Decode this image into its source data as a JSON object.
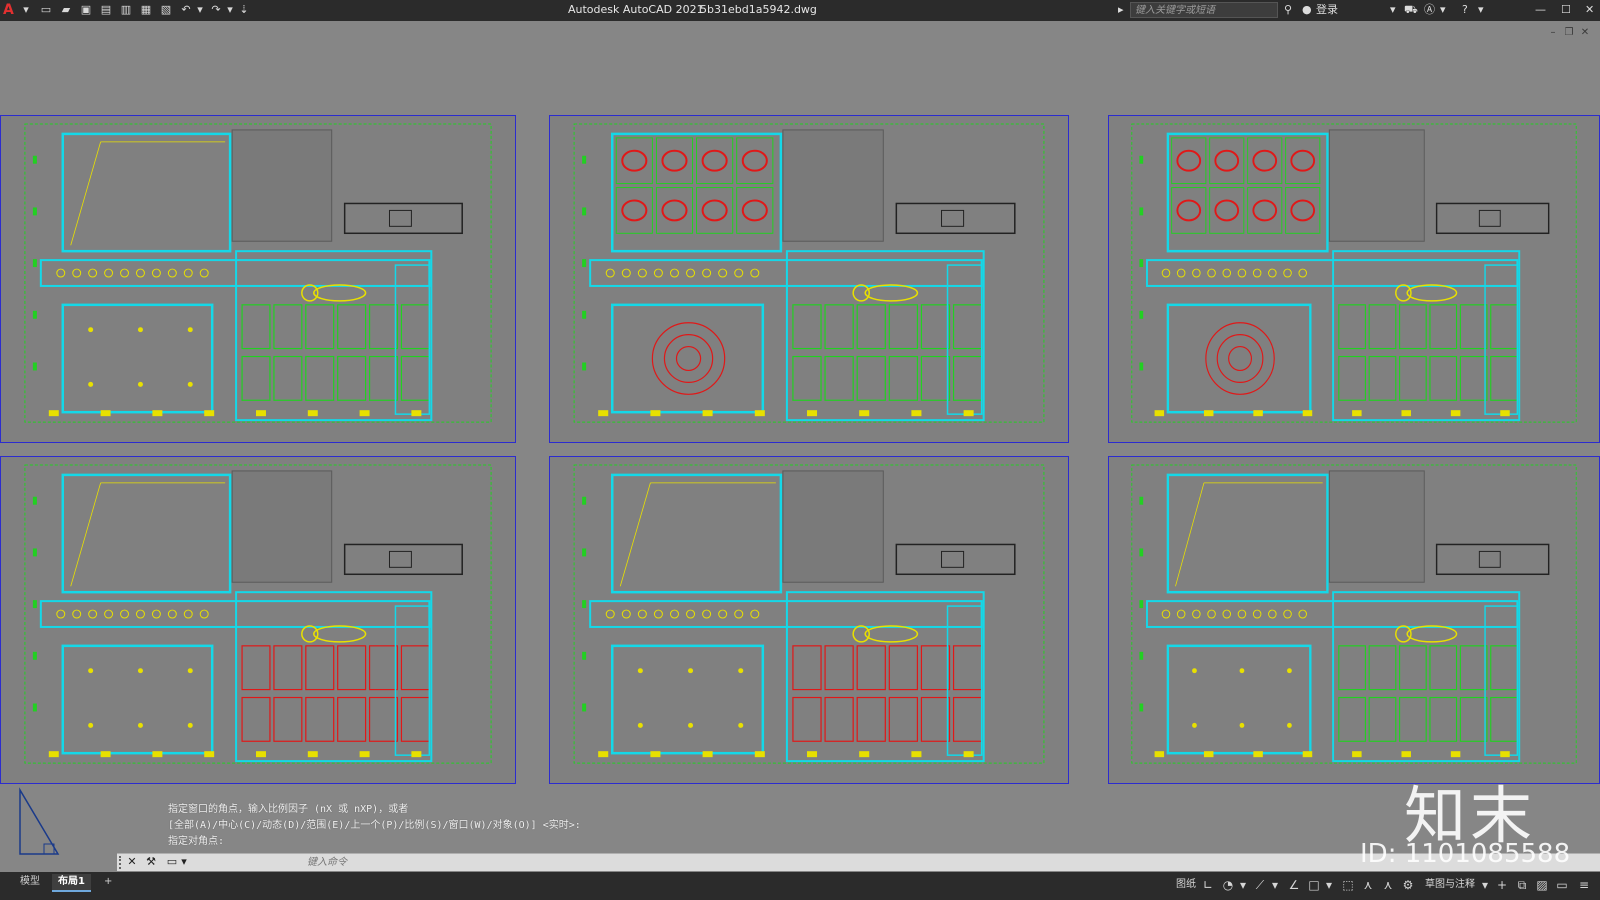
{
  "titlebar": {
    "app_title": "Autodesk AutoCAD 2021",
    "doc_title": "5b31ebd1a5942.dwg",
    "search_placeholder": "键入关键字或短语",
    "login_label": "登录",
    "icons": [
      "app-menu-icon",
      "new-icon",
      "open-icon",
      "save-icon",
      "save-as-icon",
      "publish-icon",
      "plot-icon",
      "print-icon",
      "undo-icon",
      "redo-icon",
      "customize-icon",
      "search-icon",
      "user-icon",
      "cart-icon",
      "autodesk-a360-icon",
      "help-icon",
      "minimize-icon",
      "maximize-icon",
      "close-icon"
    ]
  },
  "sheets": [
    {
      "id": "sheet-1",
      "variant": "a"
    },
    {
      "id": "sheet-2",
      "variant": "b"
    },
    {
      "id": "sheet-3",
      "variant": "b"
    },
    {
      "id": "sheet-4",
      "variant": "c"
    },
    {
      "id": "sheet-5",
      "variant": "c"
    },
    {
      "id": "sheet-6",
      "variant": "a"
    }
  ],
  "command": {
    "history": [
      "指定窗口的角点，输入比例因子 (nX 或 nXP)，或者",
      "[全部(A)/中心(C)/动态(D)/范围(E)/上一个(P)/比例(S)/窗口(W)/对象(O)] <实时>:",
      "指定对角点:"
    ],
    "input_placeholder": "键入命令"
  },
  "statusbar": {
    "tabs": [
      "模型",
      "布局1"
    ],
    "active_tab": "布局1",
    "add_tab": "+",
    "paper_label": "图纸",
    "workspace_label": "草图与注释"
  },
  "watermark": {
    "logo": "知末",
    "id_text": "ID: 1101085588"
  },
  "colors": {
    "background": "#868686",
    "sheet_border": "#2c2ccf",
    "wall_cyan": "#14d8e8",
    "green": "#22d022",
    "red": "#e01818",
    "yellow": "#e8e000",
    "white": "#ffffff"
  }
}
